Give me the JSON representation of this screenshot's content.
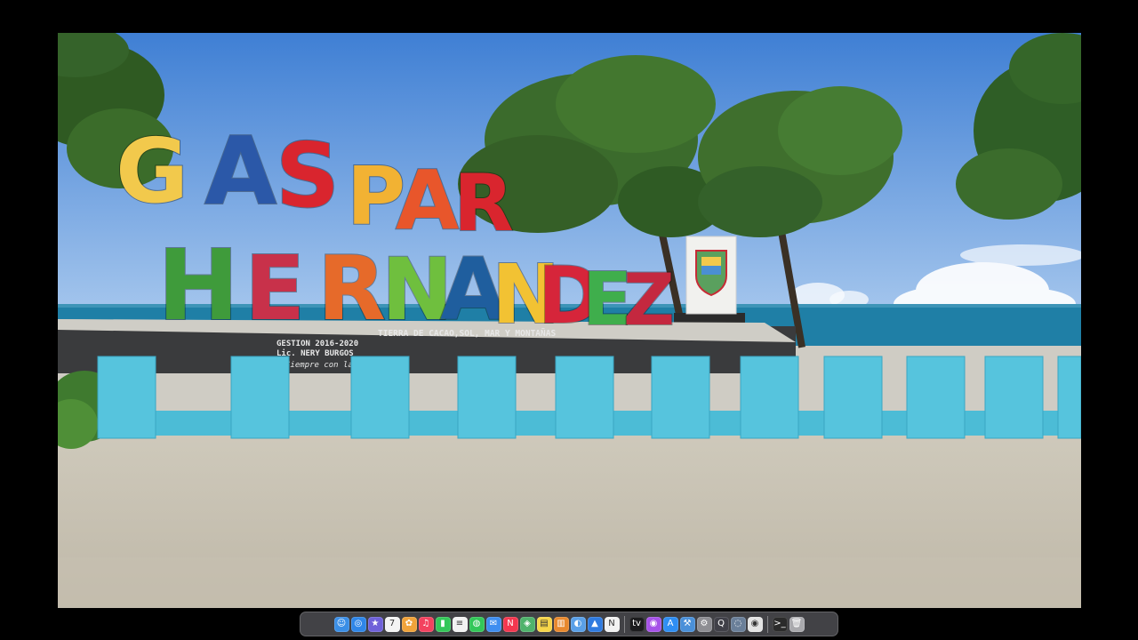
{
  "sign": {
    "top_word": "GASPAR",
    "bottom_word": "HERNANDEZ",
    "top_letters": [
      "G",
      "A",
      "S",
      "P",
      "A",
      "R"
    ],
    "bottom_letters": [
      "H",
      "E",
      "R",
      "N",
      "A",
      "N",
      "D",
      "E",
      "Z"
    ],
    "top_colors": [
      "#f2c94c",
      "#2b58a8",
      "#d9252e",
      "#f2b233",
      "#e8562b",
      "#d9252e"
    ],
    "bottom_colors": [
      "#3f9b3b",
      "#c8314a",
      "#e66a2a",
      "#6fbf3e",
      "#1f5e9e",
      "#f2c233",
      "#d6253a",
      "#3fae4c",
      "#c4283f"
    ]
  },
  "plaque": {
    "slogan": "TIERRA DE CACAO,SOL, MAR Y MONTAÑAS",
    "gestion": "GESTION 2016-2020",
    "mayor": "Lic. NERY BURGOS",
    "motto": "Siempre con la gente"
  },
  "dock": {
    "apps": [
      {
        "name": "finder-icon",
        "glyph": "☺",
        "color": "#3a8ee6"
      },
      {
        "name": "safari-icon",
        "glyph": "◎",
        "color": "#2f86e8"
      },
      {
        "name": "launchpad-icon",
        "glyph": "★",
        "color": "#6f61d9"
      },
      {
        "name": "calendar-icon",
        "glyph": "7",
        "color": "#f4f4f4"
      },
      {
        "name": "photos-icon",
        "glyph": "✿",
        "color": "#f1a33a"
      },
      {
        "name": "music-icon",
        "glyph": "♫",
        "color": "#f3425f"
      },
      {
        "name": "facetime-icon",
        "glyph": "▮",
        "color": "#34c759"
      },
      {
        "name": "reminders-icon",
        "glyph": "≡",
        "color": "#f2f2f2"
      },
      {
        "name": "messages-icon",
        "glyph": "◍",
        "color": "#33c759"
      },
      {
        "name": "mail-icon",
        "glyph": "✉",
        "color": "#3f8ef0"
      },
      {
        "name": "news-icon",
        "glyph": "N",
        "color": "#f3374f"
      },
      {
        "name": "maps-icon",
        "glyph": "◈",
        "color": "#4fb36c"
      },
      {
        "name": "notes-icon",
        "glyph": "▤",
        "color": "#f7d64a"
      },
      {
        "name": "books-icon",
        "glyph": "▥",
        "color": "#e8892e"
      },
      {
        "name": "preview-icon",
        "glyph": "◐",
        "color": "#5aa0e8"
      },
      {
        "name": "keynote-icon",
        "glyph": "▲",
        "color": "#2f7be0"
      },
      {
        "name": "apple-news-icon",
        "glyph": "N",
        "color": "#f2f2f2"
      },
      {
        "name": "apple-tv-icon",
        "glyph": "tv",
        "color": "#1c1c1e"
      },
      {
        "name": "podcasts-icon",
        "glyph": "◉",
        "color": "#a653e8"
      },
      {
        "name": "app-store-icon",
        "glyph": "A",
        "color": "#2f8ef2"
      },
      {
        "name": "xcode-icon",
        "glyph": "⚒",
        "color": "#4a90d9"
      },
      {
        "name": "system-preferences-icon",
        "glyph": "⚙",
        "color": "#8e8e93"
      },
      {
        "name": "quicktime-icon",
        "glyph": "Q",
        "color": "#404048"
      },
      {
        "name": "disk-utility-icon",
        "glyph": "◌",
        "color": "#6a7f99"
      },
      {
        "name": "chrome-icon",
        "glyph": "◉",
        "color": "#e4e4e4"
      },
      {
        "name": "terminal-icon",
        "glyph": ">_",
        "color": "#2b2b2b"
      },
      {
        "name": "trash-icon",
        "glyph": "🗑",
        "color": "#a9a9ad"
      }
    ]
  }
}
